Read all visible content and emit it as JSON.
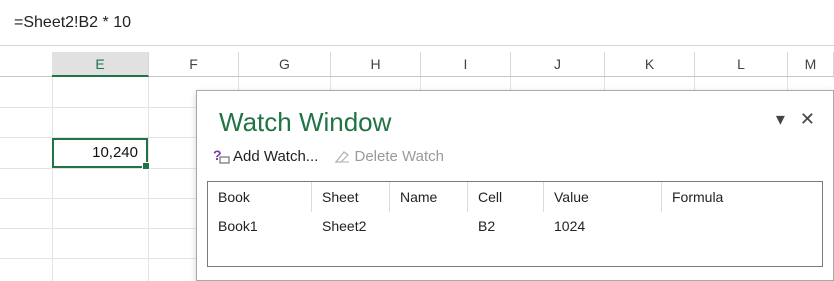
{
  "formula_bar": {
    "text": "=Sheet2!B2 * 10"
  },
  "columns": [
    "E",
    "F",
    "G",
    "H",
    "I",
    "J",
    "K",
    "L",
    "M"
  ],
  "selected_column": "E",
  "active_cell": {
    "value": "10,240"
  },
  "watch_window": {
    "title": "Watch Window",
    "add_watch": "Add Watch...",
    "delete_watch": "Delete Watch",
    "headers": [
      "Book",
      "Sheet",
      "Name",
      "Cell",
      "Value",
      "Formula"
    ],
    "rows": [
      {
        "book": "Book1",
        "sheet": "Sheet2",
        "name": "",
        "cell": "B2",
        "value": "1024",
        "formula": ""
      }
    ]
  },
  "colors": {
    "accent": "#217346"
  }
}
